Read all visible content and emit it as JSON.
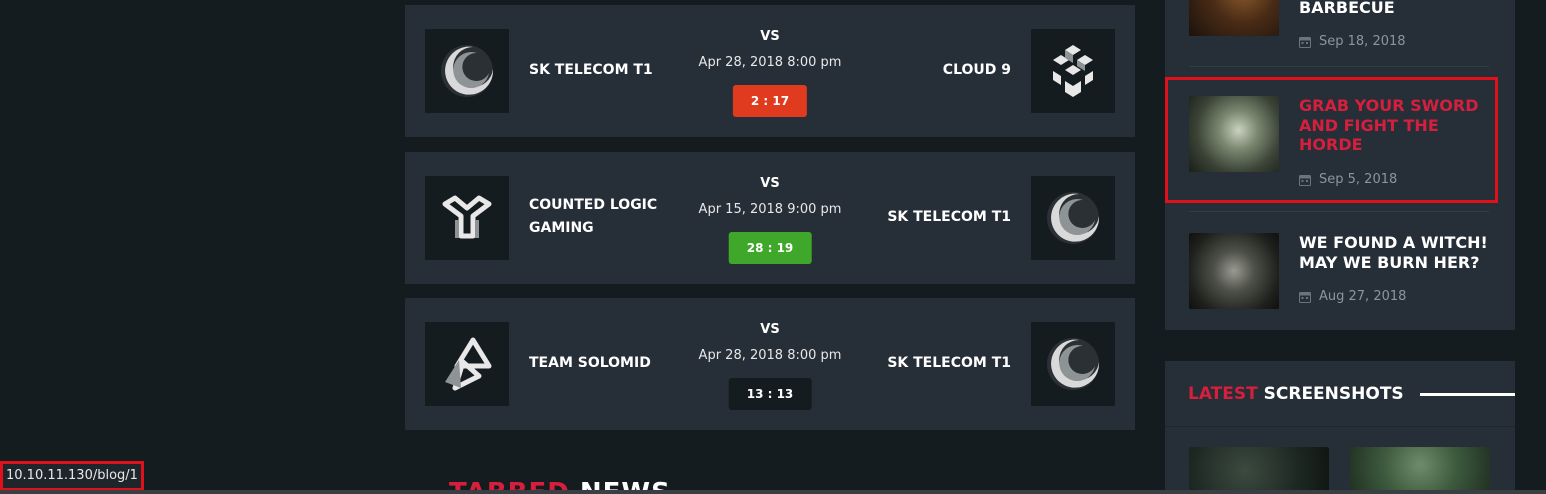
{
  "matches": [
    {
      "team_left": "SK TELECOM T1",
      "team_left_logo": "skt-crescent-logo",
      "vs": "VS",
      "date": "Apr 28, 2018 8:00 pm",
      "score": "2 : 17",
      "score_color": "#e03a1f",
      "team_right": "CLOUD 9",
      "team_right_logo": "cloud9-cube-logo"
    },
    {
      "team_left": "COUNTED LOGIC GAMING",
      "team_left_logo": "clg-y-logo",
      "vs": "VS",
      "date": "Apr 15, 2018 9:00 pm",
      "score": "28 : 19",
      "score_color": "#3fa72a",
      "team_right": "SK TELECOM T1",
      "team_right_logo": "skt-crescent-logo"
    },
    {
      "team_left": "TEAM SOLOMID",
      "team_left_logo": "tsm-triangle-logo",
      "vs": "VS",
      "date": "Apr 28, 2018 8:00 pm",
      "score": "13 : 13",
      "score_color": "#151c20",
      "team_right": "SK TELECOM T1",
      "team_right_logo": "skt-crescent-logo"
    }
  ],
  "sidebar_posts": [
    {
      "title": "BARBECUE",
      "date": "Sep 18, 2018",
      "icon": "calendar-icon"
    },
    {
      "title": "GRAB YOUR SWORD AND FIGHT THE HORDE",
      "date": "Sep 5, 2018",
      "icon": "calendar-icon",
      "highlighted": true
    },
    {
      "title": "WE FOUND A WITCH! MAY WE BURN HER?",
      "date": "Aug 27, 2018",
      "icon": "calendar-icon"
    }
  ],
  "screenshots": {
    "title_accent": "LATEST",
    "title_rest": " SCREENSHOTS"
  },
  "news": {
    "title_accent": "TABBED",
    "title_rest": " NEWS"
  },
  "status_bar": {
    "url": "10.10.11.130/blog/1"
  },
  "colors": {
    "accent": "#d51f3d",
    "panel": "#262e37",
    "background": "#151c20",
    "highlight_border": "#e0111a"
  }
}
